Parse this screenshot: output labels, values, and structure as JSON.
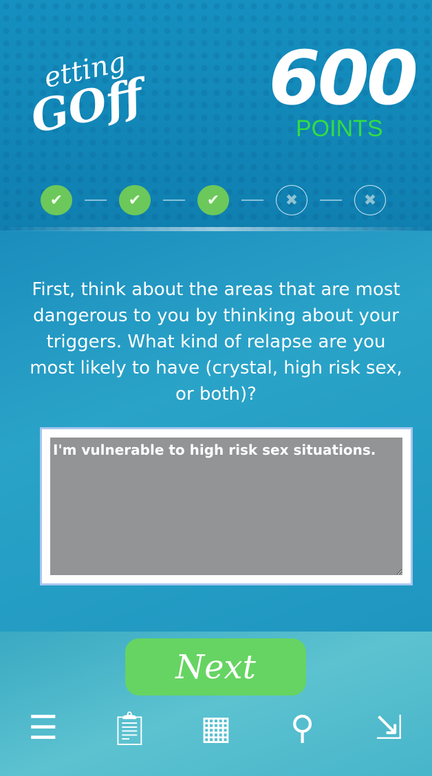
{
  "header": {
    "logo_line1": "etting",
    "logo_line2": "GOff",
    "points": "600",
    "points_label": "POINTS"
  },
  "progress": {
    "steps": [
      {
        "status": "done",
        "icon": "check-icon"
      },
      {
        "status": "done",
        "icon": "check-icon"
      },
      {
        "status": "done",
        "icon": "check-icon"
      },
      {
        "status": "incomplete",
        "icon": "x-icon"
      },
      {
        "status": "incomplete",
        "icon": "x-icon"
      }
    ],
    "completed": 3,
    "total": 5
  },
  "question": "First, think about the areas that are most dangerous to you by thinking about your triggers. What kind of relapse are you most likely to have (crystal, high risk sex, or both)?",
  "answer": "I'm vulnerable to high risk sex situations.",
  "next_label": "Next",
  "nav": [
    "menu-icon",
    "clipboard-icon",
    "calendar-icon",
    "pin-icon",
    "logout-icon"
  ],
  "colors": {
    "accent_green": "#66d462",
    "points_green": "#33dd44",
    "header_blue": "#1590c0"
  }
}
